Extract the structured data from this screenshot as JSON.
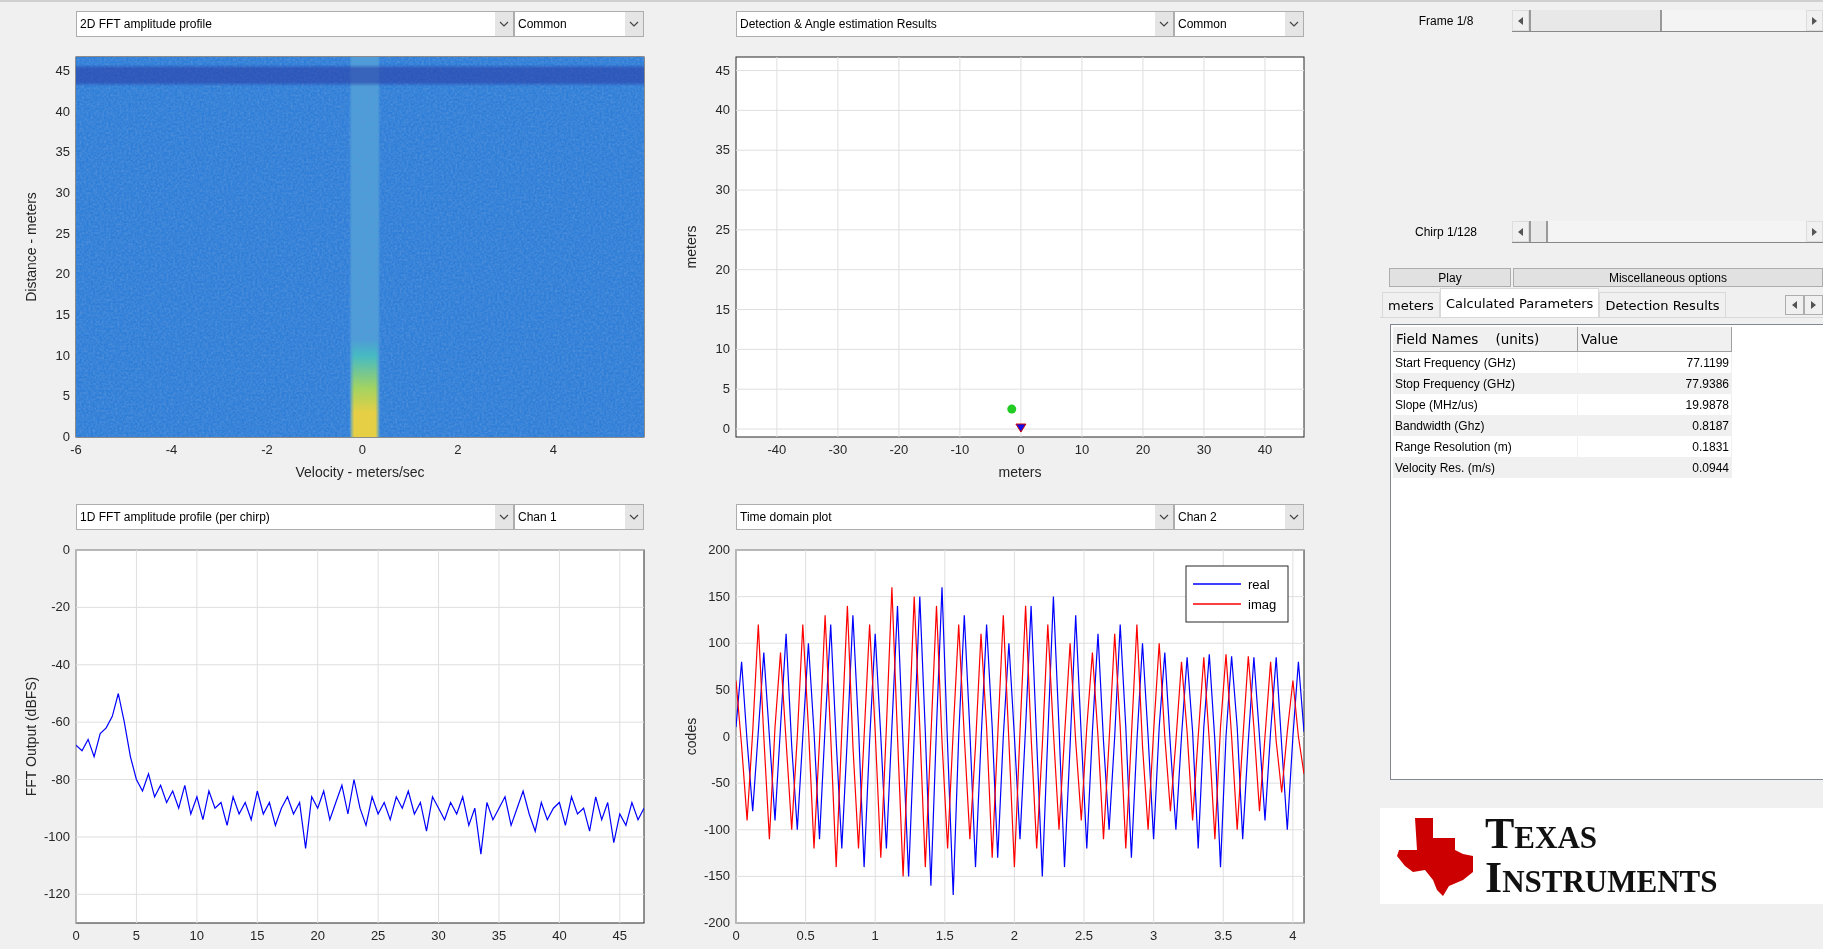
{
  "panels": [
    {
      "plot_select": "2D FFT amplitude profile",
      "channel_select": "Common",
      "chart_data": {
        "type": "heatmap",
        "xlabel": "Velocity - meters/sec",
        "ylabel": "Distance - meters",
        "xlim": [
          -6,
          5.9
        ],
        "ylim": [
          0,
          46.7
        ],
        "xticks": [
          -6,
          -4,
          -2,
          0,
          2,
          4
        ],
        "yticks": [
          0,
          5,
          10,
          15,
          20,
          25,
          30,
          35,
          40,
          45
        ]
      }
    },
    {
      "plot_select": "Detection & Angle estimation Results",
      "channel_select": "Common",
      "chart_data": {
        "type": "scatter",
        "xlabel": "meters",
        "ylabel": "meters",
        "grid": true,
        "xlim": [
          -46.7,
          46.4
        ],
        "ylim": [
          -1,
          46.7
        ],
        "xticks": [
          -40,
          -30,
          -20,
          -10,
          0,
          10,
          20,
          30,
          40
        ],
        "yticks": [
          0,
          5,
          10,
          15,
          20,
          25,
          30,
          35,
          40,
          45
        ],
        "x": [
          -1.5,
          0
        ],
        "series": [
          {
            "color": "#22cc22",
            "values": [
              2.5,
              null
            ]
          },
          {
            "color": "#1010ee",
            "values": [
              null,
              0
            ]
          }
        ]
      }
    },
    {
      "plot_select": "1D FFT amplitude profile (per chirp)",
      "channel_select": "Chan 1",
      "chart_data": {
        "type": "line",
        "ylabel": "FFT Output (dBFS)",
        "grid": true,
        "xlim": [
          0,
          47
        ],
        "ylim": [
          -130,
          0
        ],
        "xticks": [
          0,
          5,
          10,
          15,
          20,
          25,
          30,
          35,
          40,
          45
        ],
        "yticks": [
          -120,
          -100,
          -80,
          -60,
          -40,
          -20,
          0
        ],
        "x": [
          0,
          0.5,
          1,
          1.5,
          2,
          2.5,
          3,
          3.5,
          4,
          4.5,
          5,
          5.5,
          6,
          6.5,
          7,
          7.5,
          8,
          8.5,
          9,
          9.5,
          10,
          10.5,
          11,
          11.5,
          12,
          12.5,
          13,
          13.5,
          14,
          14.5,
          15,
          15.5,
          16,
          16.5,
          17,
          17.5,
          18,
          18.5,
          19,
          19.5,
          20,
          20.5,
          21,
          21.5,
          22,
          22.5,
          23,
          23.5,
          24,
          24.5,
          25,
          25.5,
          26,
          26.5,
          27,
          27.5,
          28,
          28.5,
          29,
          29.5,
          30,
          30.5,
          31,
          31.5,
          32,
          32.5,
          33,
          33.5,
          34,
          34.5,
          35,
          35.5,
          36,
          36.5,
          37,
          37.5,
          38,
          38.5,
          39,
          39.5,
          40,
          40.5,
          41,
          41.5,
          42,
          42.5,
          43,
          43.5,
          44,
          44.5,
          45,
          45.5,
          46,
          46.5,
          47
        ],
        "series": [
          {
            "color": "#0000ff",
            "values": [
              -68,
              -70,
              -66,
              -72,
              -64,
              -62,
              -58,
              -50,
              -60,
              -72,
              -80,
              -84,
              -78,
              -86,
              -82,
              -88,
              -84,
              -90,
              -82,
              -92,
              -86,
              -94,
              -84,
              -90,
              -88,
              -96,
              -86,
              -92,
              -88,
              -94,
              -84,
              -92,
              -88,
              -96,
              -90,
              -86,
              -92,
              -88,
              -104,
              -86,
              -90,
              -84,
              -94,
              -88,
              -82,
              -92,
              -80,
              -90,
              -96,
              -86,
              -92,
              -88,
              -94,
              -86,
              -90,
              -84,
              -92,
              -88,
              -98,
              -86,
              -90,
              -94,
              -88,
              -92,
              -86,
              -96,
              -90,
              -106,
              -88,
              -94,
              -90,
              -86,
              -96,
              -90,
              -84,
              -92,
              -98,
              -88,
              -94,
              -90,
              -88,
              -96,
              -86,
              -92,
              -90,
              -98,
              -86,
              -94,
              -88,
              -102,
              -92,
              -96,
              -88,
              -94,
              -90
            ]
          }
        ]
      }
    },
    {
      "plot_select": "Time domain plot",
      "channel_select": "Chan 2",
      "chart_data": {
        "type": "line",
        "ylabel": "codes",
        "grid": true,
        "legend": true,
        "xlim": [
          0,
          4.08
        ],
        "ylim": [
          -200,
          200
        ],
        "xticks": [
          0,
          0.5,
          1,
          1.5,
          2,
          2.5,
          3,
          3.5,
          4
        ],
        "yticks": [
          -200,
          -150,
          -100,
          -50,
          0,
          50,
          100,
          150,
          200
        ],
        "x": [
          0,
          0.04,
          0.08,
          0.12,
          0.16,
          0.2,
          0.24,
          0.28,
          0.32,
          0.36,
          0.4,
          0.44,
          0.48,
          0.52,
          0.56,
          0.6,
          0.64,
          0.68,
          0.72,
          0.76,
          0.8,
          0.84,
          0.88,
          0.92,
          0.96,
          1,
          1.04,
          1.08,
          1.12,
          1.16,
          1.2,
          1.24,
          1.28,
          1.32,
          1.36,
          1.4,
          1.44,
          1.48,
          1.52,
          1.56,
          1.6,
          1.64,
          1.68,
          1.72,
          1.76,
          1.8,
          1.84,
          1.88,
          1.92,
          1.96,
          2,
          2.04,
          2.08,
          2.12,
          2.16,
          2.2,
          2.24,
          2.28,
          2.32,
          2.36,
          2.4,
          2.44,
          2.48,
          2.52,
          2.56,
          2.6,
          2.64,
          2.68,
          2.72,
          2.76,
          2.8,
          2.84,
          2.88,
          2.92,
          2.96,
          3,
          3.04,
          3.08,
          3.12,
          3.16,
          3.2,
          3.24,
          3.28,
          3.32,
          3.36,
          3.4,
          3.44,
          3.48,
          3.52,
          3.56,
          3.6,
          3.64,
          3.68,
          3.72,
          3.76,
          3.8,
          3.84,
          3.88,
          3.92,
          3.96,
          4,
          4.04,
          4.08
        ],
        "series": [
          {
            "name": "real",
            "color": "#0000ff",
            "values": [
              10,
              80,
              -5,
              -80,
              5,
              90,
              0,
              -90,
              10,
              110,
              -10,
              -100,
              0,
              100,
              5,
              -110,
              10,
              120,
              -5,
              -120,
              0,
              130,
              10,
              -140,
              -5,
              110,
              0,
              -120,
              10,
              140,
              -10,
              -150,
              0,
              150,
              5,
              -160,
              10,
              160,
              -10,
              -170,
              0,
              130,
              5,
              -140,
              -5,
              120,
              10,
              -130,
              0,
              100,
              0,
              -110,
              10,
              140,
              -5,
              -150,
              0,
              150,
              10,
              -140,
              -10,
              130,
              0,
              -120,
              5,
              110,
              -5,
              -100,
              0,
              120,
              10,
              -130,
              -5,
              100,
              0,
              -110,
              10,
              90,
              -10,
              -100,
              0,
              85,
              5,
              -120,
              10,
              88,
              -5,
              -140,
              0,
              86,
              10,
              -110,
              -5,
              85,
              0,
              -90,
              5,
              85,
              -10,
              -100,
              0,
              80,
              5
            ]
          },
          {
            "name": "imag",
            "color": "#ff0000",
            "values": [
              60,
              -10,
              -90,
              5,
              120,
              0,
              -110,
              10,
              90,
              -5,
              -100,
              0,
              120,
              10,
              -120,
              -5,
              130,
              0,
              -140,
              5,
              140,
              -10,
              -120,
              0,
              120,
              5,
              -130,
              10,
              160,
              0,
              -150,
              -5,
              150,
              10,
              -140,
              0,
              140,
              -5,
              -120,
              5,
              120,
              0,
              -110,
              -10,
              110,
              10,
              -130,
              0,
              130,
              -5,
              -140,
              5,
              140,
              0,
              -120,
              -10,
              120,
              5,
              -100,
              0,
              100,
              -5,
              -90,
              10,
              90,
              0,
              -110,
              -5,
              110,
              10,
              -120,
              0,
              120,
              -10,
              -100,
              5,
              100,
              0,
              -80,
              -5,
              80,
              5,
              -90,
              0,
              85,
              -5,
              -110,
              10,
              88,
              0,
              -100,
              -5,
              86,
              10,
              -80,
              0,
              80,
              -5,
              -60,
              5,
              60,
              0,
              -40
            ]
          }
        ]
      }
    }
  ],
  "sliders": [
    {
      "label": "Frame 1/8",
      "level": 0
    },
    {
      "label": "Chirp 1/128",
      "level": 0
    }
  ],
  "buttons": [
    {
      "label": "Play"
    },
    {
      "label": "Miscellaneous options"
    }
  ],
  "tabs": [
    {
      "label": "meters",
      "selected": false
    },
    {
      "label": "Calculated Parameters",
      "selected": true
    },
    {
      "label": "Detection Results",
      "selected": false
    }
  ],
  "table": {
    "columns": [
      "Field Names    (units)",
      "Value"
    ],
    "rows": [
      [
        "Start Frequency (GHz)",
        "77.1199"
      ],
      [
        "Stop Frequency (GHz)",
        "77.9386"
      ],
      [
        "Slope (MHz/us)",
        "19.9878"
      ],
      [
        "Bandwidth (Ghz)",
        "0.8187"
      ],
      [
        "Range Resolution (m)",
        "0.1831"
      ],
      [
        "Velocity Res. (m/s)",
        "0.0944"
      ]
    ]
  },
  "logo": {
    "lines": [
      "TEXAS",
      "INSTRUMENTS"
    ]
  }
}
